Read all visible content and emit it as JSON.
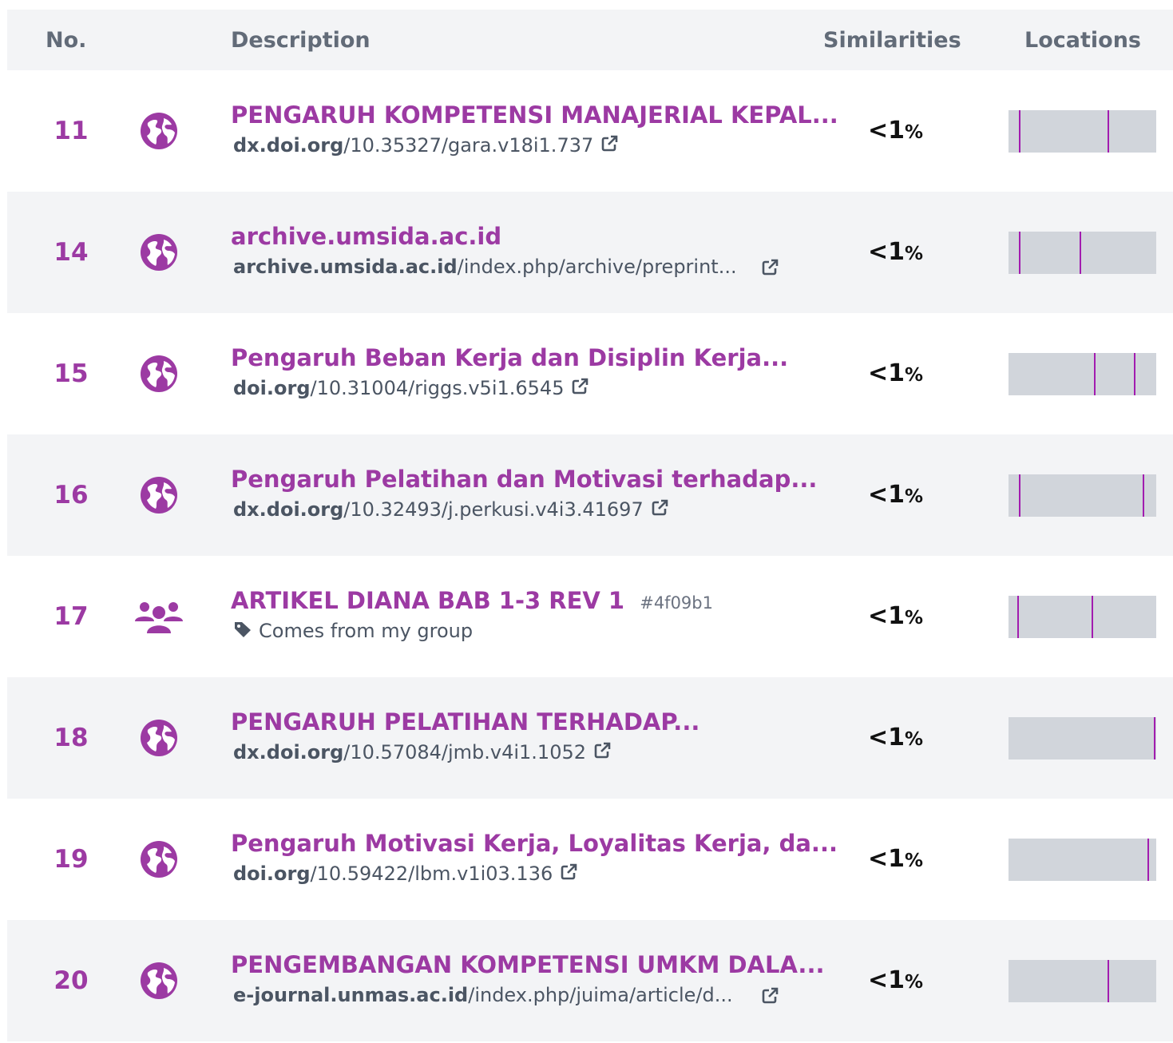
{
  "header": {
    "no": "No.",
    "description": "Description",
    "similarities": "Similarities",
    "locations": "Locations"
  },
  "colors": {
    "accent": "#9c3aa3",
    "row_alt": "#f3f4f6",
    "location_bar": "#d1d5db",
    "location_mark": "#a21caf"
  },
  "rows": [
    {
      "no": "11",
      "icon": "globe-icon",
      "title": "PENGARUH KOMPETENSI MANAJERIAL KEPAL...",
      "domain": "dx.doi.org",
      "path": "/10.35327/gara.v18i1.737",
      "sim": "<1",
      "pct": "%",
      "marks": [
        0.07,
        0.67
      ]
    },
    {
      "no": "14",
      "icon": "globe-icon",
      "title": "archive.umsida.ac.id",
      "domain": "archive.umsida.ac.id",
      "path": "/index.php/archive/preprint...",
      "sim": "<1",
      "pct": "%",
      "marks": [
        0.07,
        0.48
      ],
      "ext_far": true
    },
    {
      "no": "15",
      "icon": "globe-icon",
      "title": "Pengaruh Beban Kerja dan Disiplin Kerja...",
      "domain": "doi.org",
      "path": "/10.31004/riggs.v5i1.6545",
      "sim": "<1",
      "pct": "%",
      "marks": [
        0.58,
        0.85
      ]
    },
    {
      "no": "16",
      "icon": "globe-icon",
      "title": "Pengaruh Pelatihan dan Motivasi terhadap...",
      "domain": "dx.doi.org",
      "path": "/10.32493/j.perkusi.v4i3.41697",
      "sim": "<1",
      "pct": "%",
      "marks": [
        0.07,
        0.91
      ]
    },
    {
      "no": "17",
      "icon": "group-icon",
      "title": "ARTIKEL DIANA BAB 1-3 REV 1",
      "hash": "#4f09b1",
      "group_label": "Comes from my group",
      "sim": "<1",
      "pct": "%",
      "marks": [
        0.06,
        0.56
      ]
    },
    {
      "no": "18",
      "icon": "globe-icon",
      "title": "PENGARUH PELATIHAN TERHADAP...",
      "domain": "dx.doi.org",
      "path": "/10.57084/jmb.v4i1.1052",
      "sim": "<1",
      "pct": "%",
      "marks": [
        0.985
      ]
    },
    {
      "no": "19",
      "icon": "globe-icon",
      "title": "Pengaruh Motivasi Kerja, Loyalitas Kerja, da...",
      "domain": "doi.org",
      "path": "/10.59422/lbm.v1i03.136",
      "sim": "<1",
      "pct": "%",
      "marks": [
        0.94
      ]
    },
    {
      "no": "20",
      "icon": "globe-icon",
      "title": "PENGEMBANGAN KOMPETENSI UMKM DALA...",
      "domain": "e-journal.unmas.ac.id",
      "path": "/index.php/juima/article/d...",
      "sim": "<1",
      "pct": "%",
      "marks": [
        0.67
      ],
      "ext_far": true
    }
  ]
}
